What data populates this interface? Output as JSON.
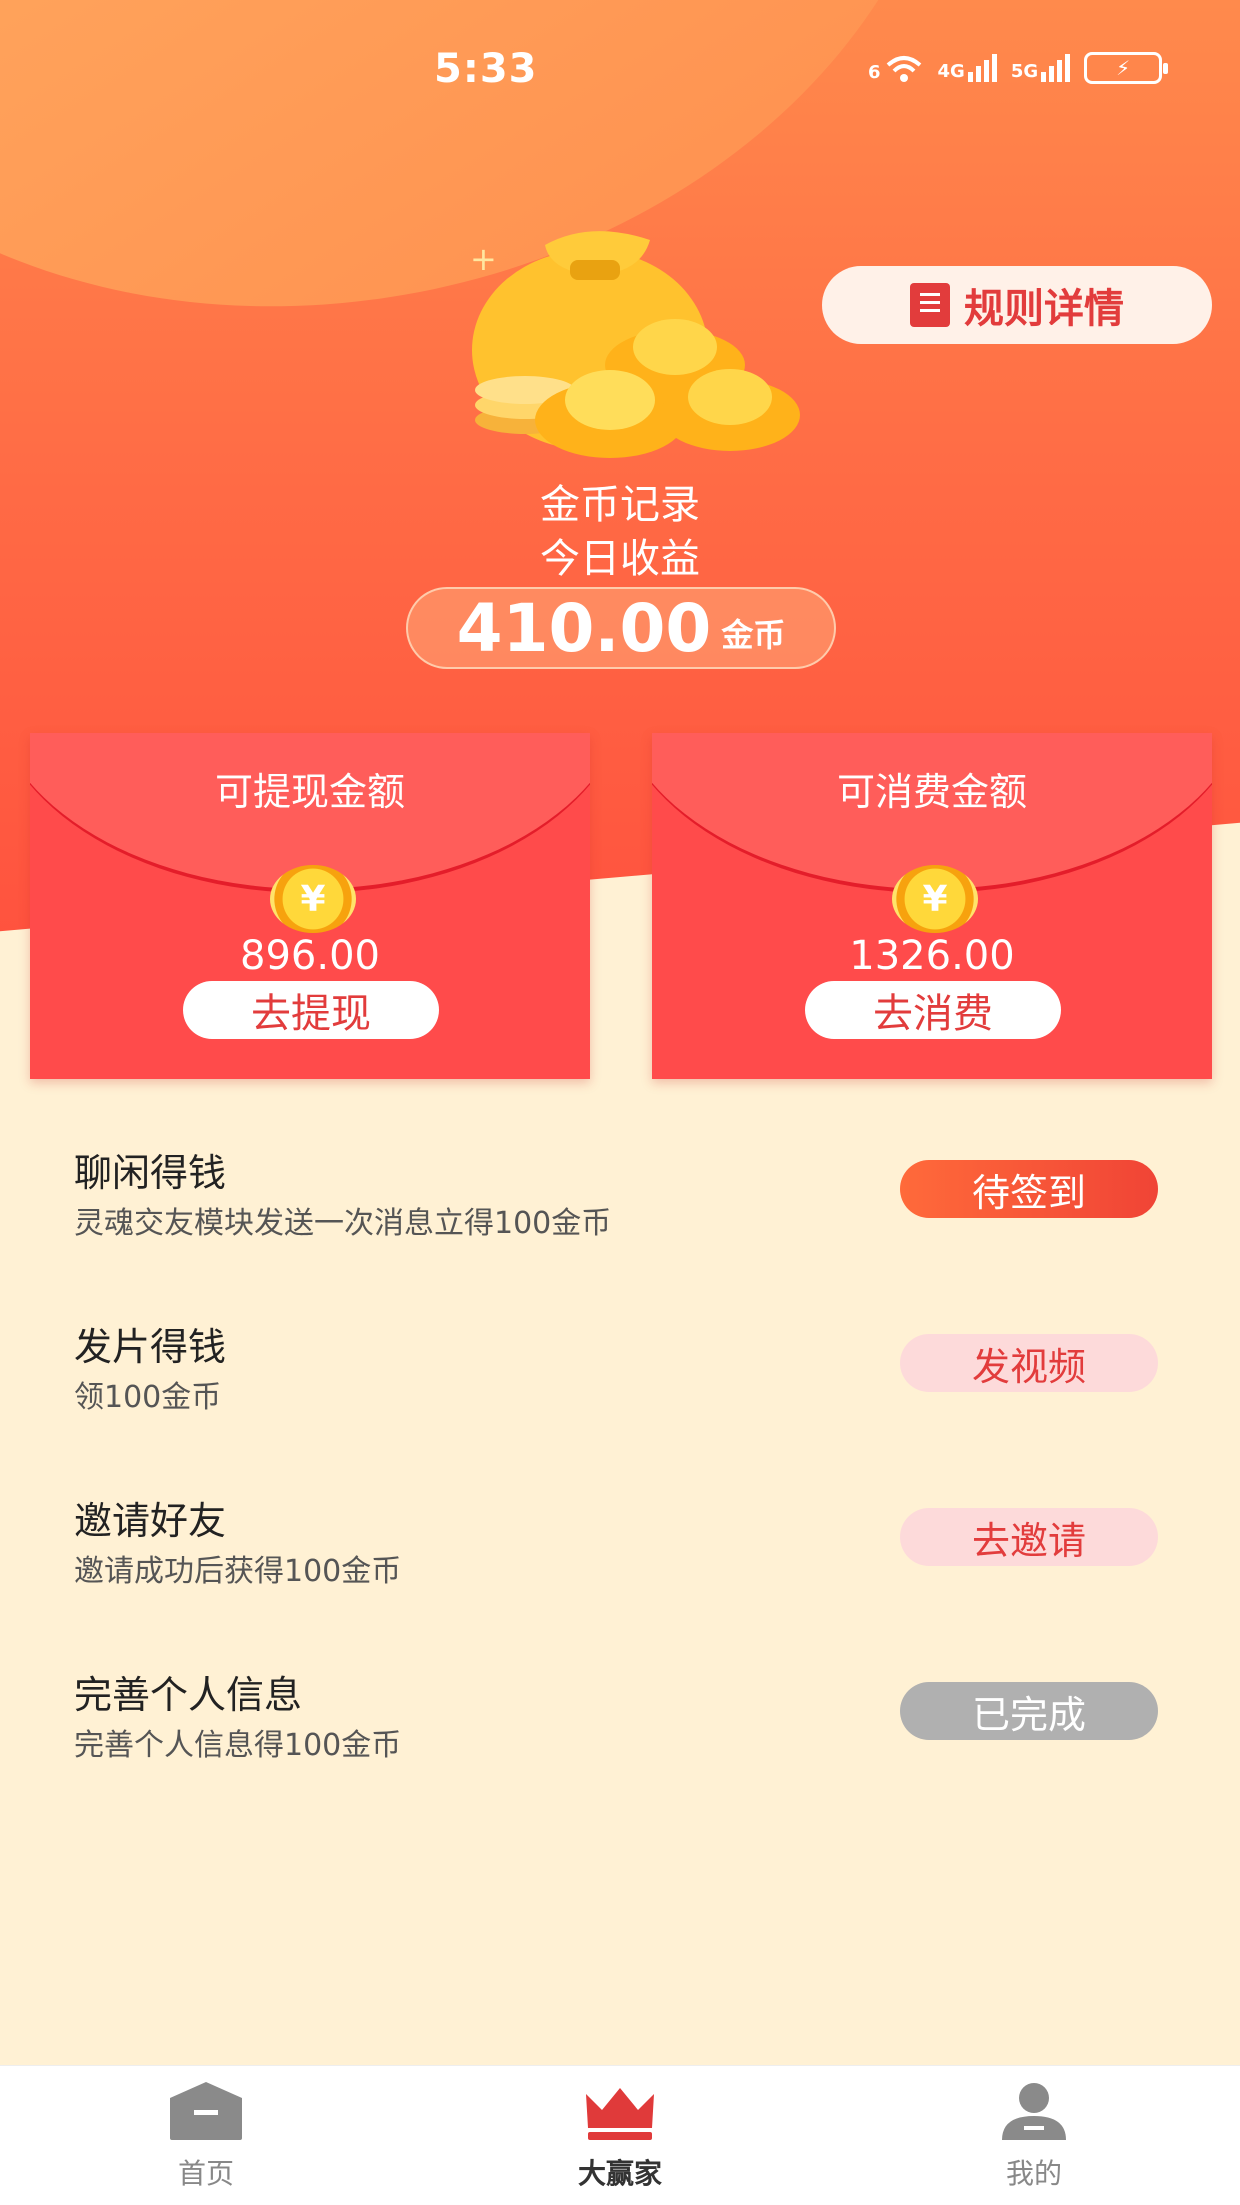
{
  "status_bar": {
    "time": "5:33",
    "wifi": "6",
    "net1": "4G",
    "net2": "5G"
  },
  "header": {
    "rules_label": "规则详情"
  },
  "earnings": {
    "record_label": "金币记录",
    "today_label": "今日收益",
    "amount": "410.00",
    "unit": "金币"
  },
  "envelopes": [
    {
      "title": "可提现金额",
      "amount": "896.00",
      "action": "去提现"
    },
    {
      "title": "可消费金额",
      "amount": "1326.00",
      "action": "去消费"
    }
  ],
  "tasks": [
    {
      "title": "聊闲得钱",
      "subtitle": "灵魂交友模块发送一次消息立得100金币",
      "action": "待签到",
      "state": "primary"
    },
    {
      "title": "发片得钱",
      "subtitle": "领100金币",
      "action": "发视频",
      "state": "soft"
    },
    {
      "title": "邀请好友",
      "subtitle": "邀请成功后获得100金币",
      "action": "去邀请",
      "state": "soft"
    },
    {
      "title": "完善个人信息",
      "subtitle": "完善个人信息得100金币",
      "action": "已完成",
      "state": "done"
    }
  ],
  "tabbar": {
    "items": [
      {
        "label": "首页",
        "icon": "home-icon"
      },
      {
        "label": "大赢家",
        "icon": "crown-icon"
      },
      {
        "label": "我的",
        "icon": "user-icon"
      }
    ],
    "active": 1
  },
  "colors": {
    "accent": "#e23c3c",
    "envelope": "#ff4b4b",
    "background": "#fff1d4"
  }
}
